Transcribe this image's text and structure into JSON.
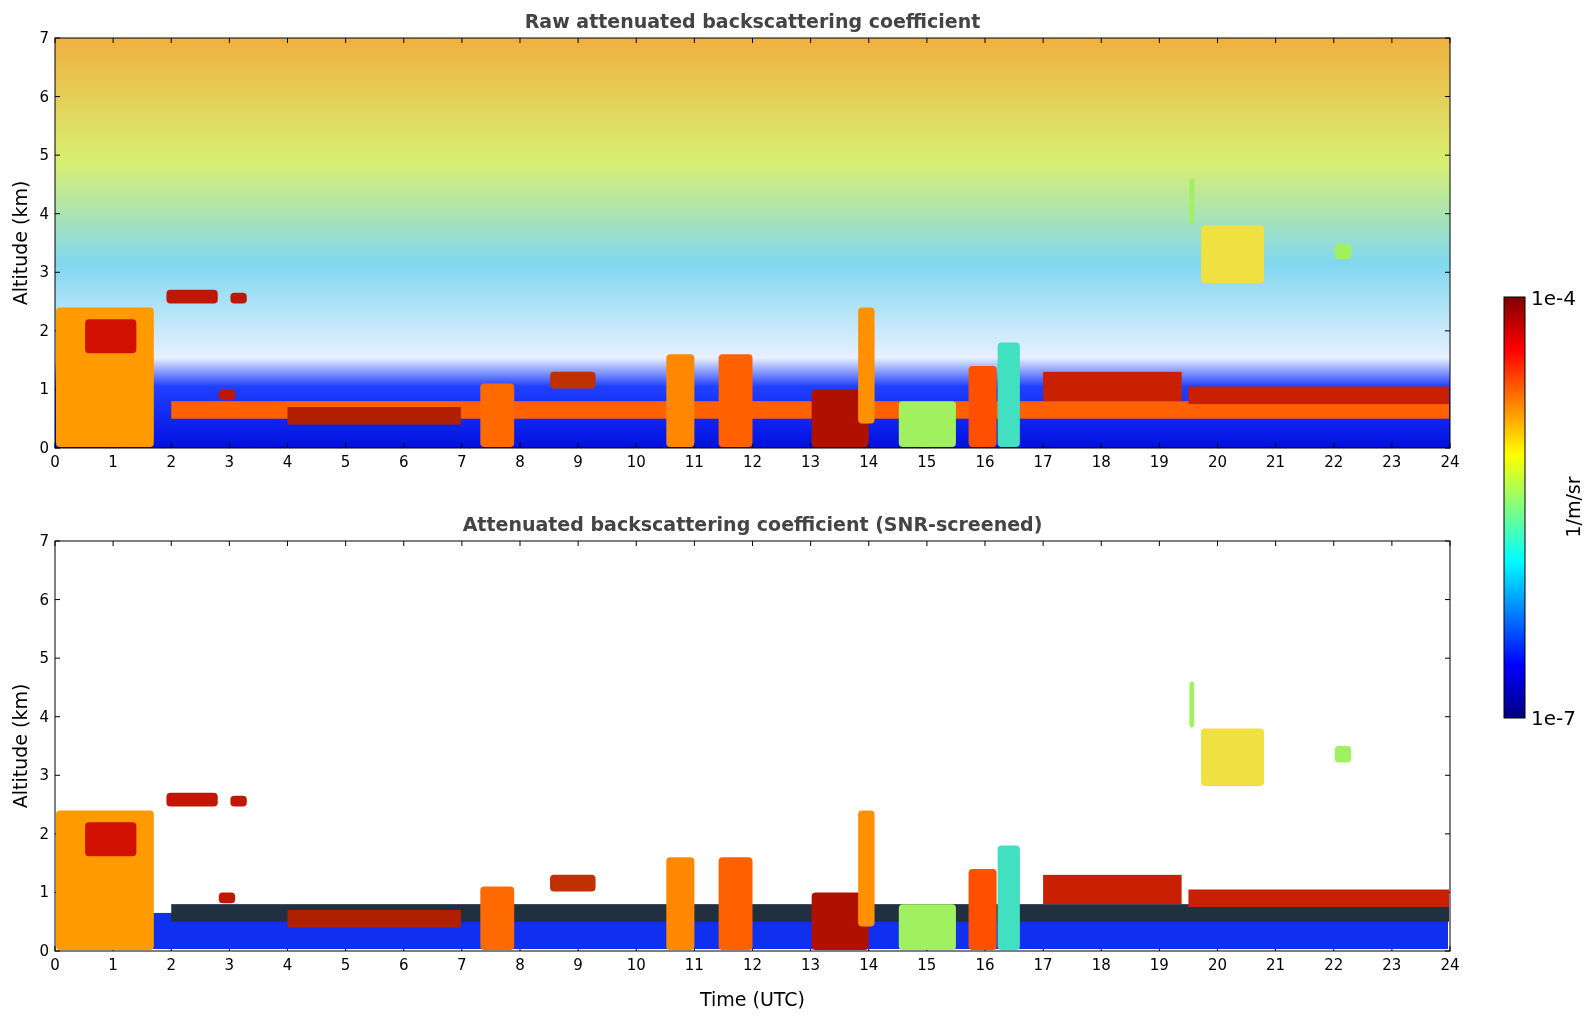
{
  "panels": [
    {
      "title": "Raw attenuated backscattering coefficient",
      "ylabel": "Altitude (km)",
      "yticks": [
        "7",
        "6",
        "5",
        "4",
        "3",
        "2",
        "1",
        "0"
      ],
      "xticks": [
        "0",
        "1",
        "2",
        "3",
        "4",
        "5",
        "6",
        "7",
        "8",
        "9",
        "10",
        "11",
        "12",
        "13",
        "14",
        "15",
        "16",
        "17",
        "18",
        "19",
        "20",
        "21",
        "22",
        "23",
        "24"
      ],
      "kind": "raw"
    },
    {
      "title": "Attenuated backscattering coefficient (SNR-screened)",
      "ylabel": "Altitude (km)",
      "yticks": [
        "7",
        "6",
        "5",
        "4",
        "3",
        "2",
        "1",
        "0"
      ],
      "xticks": [
        "0",
        "1",
        "2",
        "3",
        "4",
        "5",
        "6",
        "7",
        "8",
        "9",
        "10",
        "11",
        "12",
        "13",
        "14",
        "15",
        "16",
        "17",
        "18",
        "19",
        "20",
        "21",
        "22",
        "23",
        "24"
      ],
      "kind": "screened",
      "xlabel": "Time (UTC)"
    }
  ],
  "colorbar": {
    "max": "1e-4",
    "min": "1e-7",
    "label": "1/m/sr"
  }
}
